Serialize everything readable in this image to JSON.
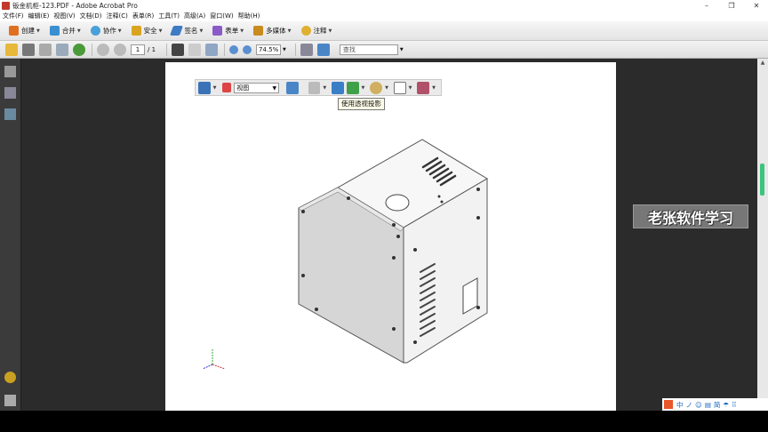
{
  "window": {
    "title": "钣金机柜-123.PDF - Adobe Acrobat Pro",
    "controls": [
      "–",
      "❐",
      "✕"
    ]
  },
  "menubar": {
    "items": [
      "文件(F)",
      "编辑(E)",
      "视图(V)",
      "文档(D)",
      "注释(C)",
      "表单(R)",
      "工具(T)",
      "高级(A)",
      "窗口(W)",
      "帮助(H)"
    ]
  },
  "toolbar1": {
    "items": [
      {
        "label": "创建",
        "icon": "create-pdf-icon",
        "color": "#e07020"
      },
      {
        "label": "合并",
        "icon": "combine-icon",
        "color": "#3a8fd0"
      },
      {
        "label": "协作",
        "icon": "collaborate-icon",
        "color": "#4aa0d8"
      },
      {
        "label": "安全",
        "icon": "lock-icon",
        "color": "#d9a520"
      },
      {
        "label": "签名",
        "icon": "pen-icon",
        "color": "#3e7bc4"
      },
      {
        "label": "表单",
        "icon": "form-icon",
        "color": "#8a5bc6"
      },
      {
        "label": "多媒体",
        "icon": "multimedia-icon",
        "color": "#c98a1e"
      },
      {
        "label": "注释",
        "icon": "comment-icon",
        "color": "#e0b030"
      }
    ]
  },
  "toolbar2": {
    "page_current": "1",
    "page_total": "/ 1",
    "zoom": "74.5%",
    "find_placeholder": "查找"
  },
  "toolbar3d": {
    "view_select": "视图",
    "tooltip": "使用透视投影"
  },
  "watermark": {
    "text": "老张软件学习"
  },
  "ime": {
    "items": [
      "中",
      "ノ",
      "☺",
      "▤",
      "简",
      "☂",
      "⠿"
    ]
  },
  "colors": {
    "workarea": "#2b2b2b",
    "page": "#ffffff",
    "scroll_thumb": "#3cc47c"
  }
}
